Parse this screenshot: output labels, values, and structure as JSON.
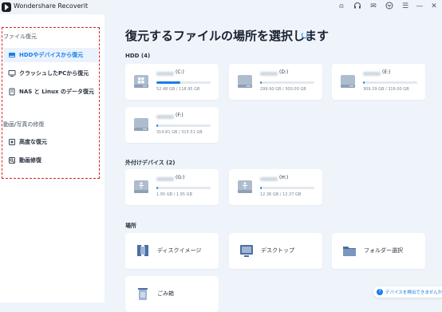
{
  "app": {
    "title": "Wondershare Recoverit"
  },
  "titlebar_icons": [
    "user-icon",
    "headset-icon",
    "mail-icon",
    "gift-icon",
    "menu-icon",
    "minimize-icon",
    "close-icon"
  ],
  "titlebar_glyphs": {
    "user": "⍝",
    "headset": "🎧",
    "mail": "✉",
    "gift": "⌂",
    "menu": "☰",
    "minimize": "—",
    "close": "✕"
  },
  "sidebar": {
    "file_recovery_label": "ファイル復元",
    "items": [
      {
        "label": "HDDやデバイスから復元",
        "icon": "hdd-icon",
        "active": true
      },
      {
        "label": "クラッシュしたPCから復元",
        "icon": "pc-icon",
        "active": false
      },
      {
        "label": "NAS と Linux のデータ復元",
        "icon": "nas-icon",
        "active": false
      }
    ],
    "video_label": "動画/写真の修復",
    "video_items": [
      {
        "label": "高度な復元",
        "icon": "advanced-recovery-icon"
      },
      {
        "label": "動画修復",
        "icon": "video-repair-icon"
      }
    ]
  },
  "main": {
    "title": "復元するファイルの場所を選択します",
    "hdd_label": "HDD (4)",
    "hdd_drives": [
      {
        "name": "(C:)",
        "size": "52.48 GB / 118.95 GB",
        "used": 0.44,
        "os": true
      },
      {
        "name": "(D:)",
        "size": "299.90 GB / 300.00 GB",
        "used": 0.03
      },
      {
        "name": "(E:)",
        "size": "309.29 GB / 316.00 GB",
        "used": 0.03
      },
      {
        "name": "(F:)",
        "size": "314.81 GB / 315.51 GB",
        "used": 0.03
      }
    ],
    "external_label": "外付けデバイス (2)",
    "external_drives": [
      {
        "name": "(G:)",
        "size": "1.95 GB / 1.95 GB",
        "used": 0.03
      },
      {
        "name": "(H:)",
        "size": "12.36 GB / 12.37 GB",
        "used": 0.03
      }
    ],
    "location_label": "場所",
    "locations": [
      {
        "label": "ディスクイメージ",
        "icon": "disk-image-icon"
      },
      {
        "label": "デスクトップ",
        "icon": "desktop-icon"
      },
      {
        "label": "フォルダー選択",
        "icon": "folder-icon"
      },
      {
        "label": "ごみ箱",
        "icon": "trash-icon"
      }
    ]
  },
  "help": {
    "text": "デバイスを検出できませんか？",
    "glyph": "?"
  },
  "colors": {
    "accent": "#1a7de8",
    "background": "#eef4fa",
    "highlight": "#e02020"
  }
}
